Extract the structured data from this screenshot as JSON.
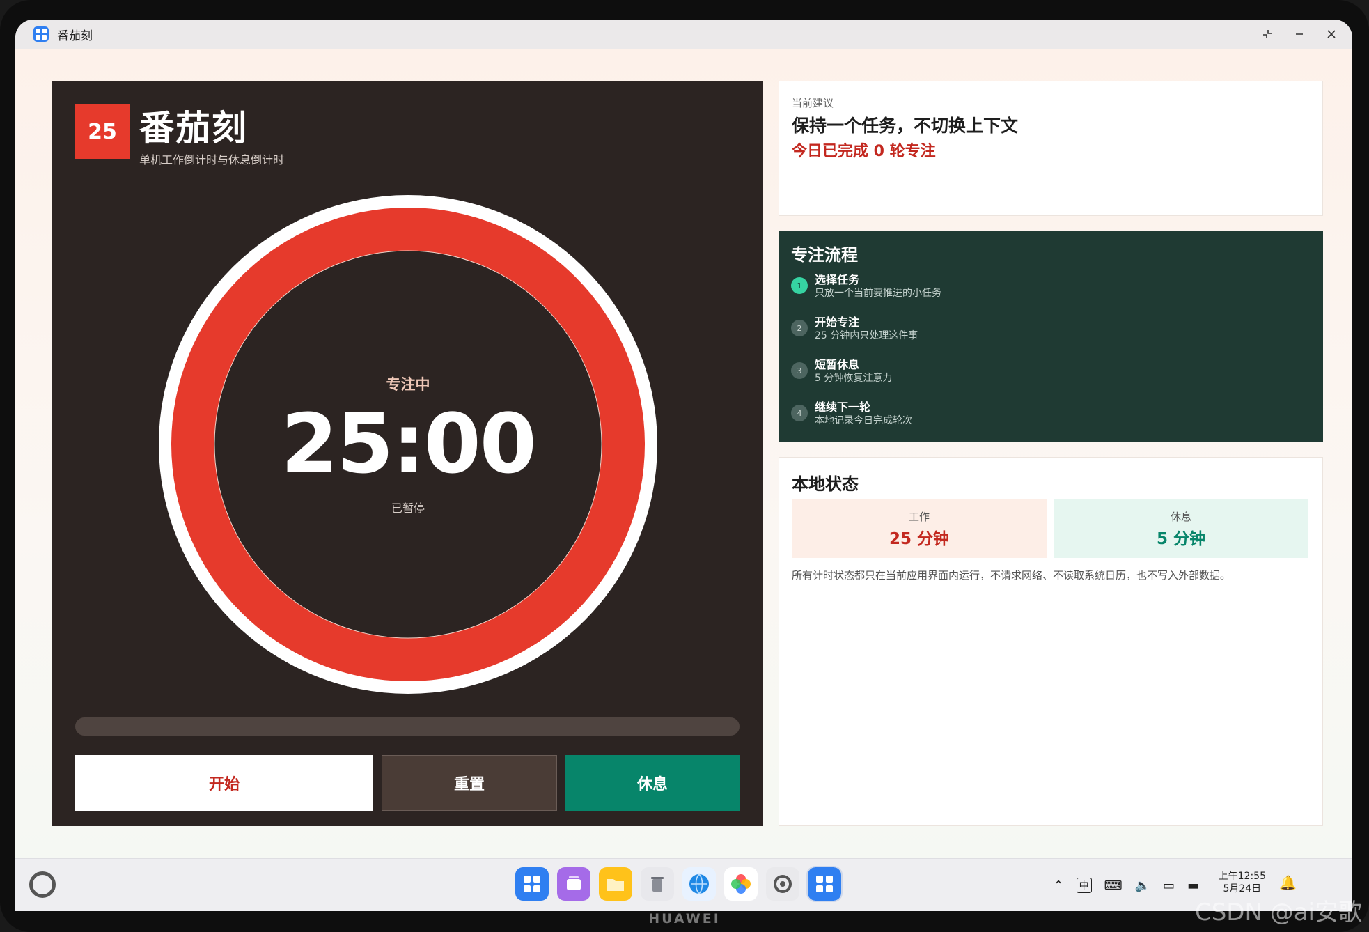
{
  "window": {
    "title": "番茄刻"
  },
  "timer": {
    "badge": "25",
    "app_name": "番茄刻",
    "subtitle": "单机工作倒计时与休息倒计时",
    "state": "专注中",
    "time": "25:00",
    "status": "已暂停",
    "progress": 0
  },
  "buttons": {
    "start": "开始",
    "reset": "重置",
    "rest": "休息"
  },
  "suggestion": {
    "label": "当前建议",
    "title": "保持一个任务，不切换上下文",
    "count": "今日已完成 0 轮专注"
  },
  "flow": {
    "title": "专注流程",
    "steps": [
      {
        "num": "1",
        "title": "选择任务",
        "desc": "只放一个当前要推进的小任务"
      },
      {
        "num": "2",
        "title": "开始专注",
        "desc": "25 分钟内只处理这件事"
      },
      {
        "num": "3",
        "title": "短暂休息",
        "desc": "5 分钟恢复注意力"
      },
      {
        "num": "4",
        "title": "继续下一轮",
        "desc": "本地记录今日完成轮次"
      }
    ]
  },
  "local": {
    "title": "本地状态",
    "work_label": "工作",
    "work_value": "25 分钟",
    "rest_label": "休息",
    "rest_value": "5 分钟",
    "note": "所有计时状态都只在当前应用界面内运行，不请求网络、不读取系统日历，也不写入外部数据。"
  },
  "taskbar": {
    "ime": "中",
    "time": "上午12:55",
    "date": "5月24日"
  },
  "device": {
    "brand": "HUAWEI"
  },
  "watermark": "CSDN @ai安歌",
  "colors": {
    "accent_red": "#e63a2c",
    "accent_green": "#07856a",
    "panel_dark": "#2c2422",
    "flow_bg": "#1f3a33"
  }
}
